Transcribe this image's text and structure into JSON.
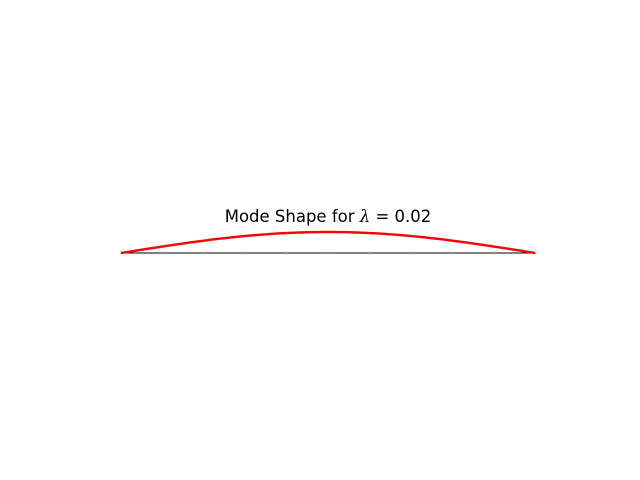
{
  "chart_data": {
    "type": "line",
    "title": "Mode Shape for ",
    "title_math": "λ = 0.02",
    "title_math_parts": {
      "symbol": "λ",
      "equals": " = ",
      "value": "0.02"
    },
    "xlabel": "",
    "ylabel": "",
    "x": [
      0,
      0.1,
      0.2,
      0.3,
      0.4,
      0.5,
      0.6,
      0.7,
      0.8,
      0.9,
      1.0
    ],
    "series": [
      {
        "values": [
          0,
          0.309,
          0.588,
          0.809,
          0.951,
          1.0,
          0.951,
          0.809,
          0.588,
          0.309,
          0
        ],
        "color": "#ff0000"
      }
    ],
    "baseline": {
      "values": [
        0,
        0,
        0,
        0,
        0,
        0,
        0,
        0,
        0,
        0,
        0
      ],
      "color": "#000000"
    },
    "xlim": [
      0,
      1
    ],
    "ylim": [
      -1,
      1
    ],
    "grid": false,
    "axes_visible": false,
    "equal_aspect": true
  }
}
